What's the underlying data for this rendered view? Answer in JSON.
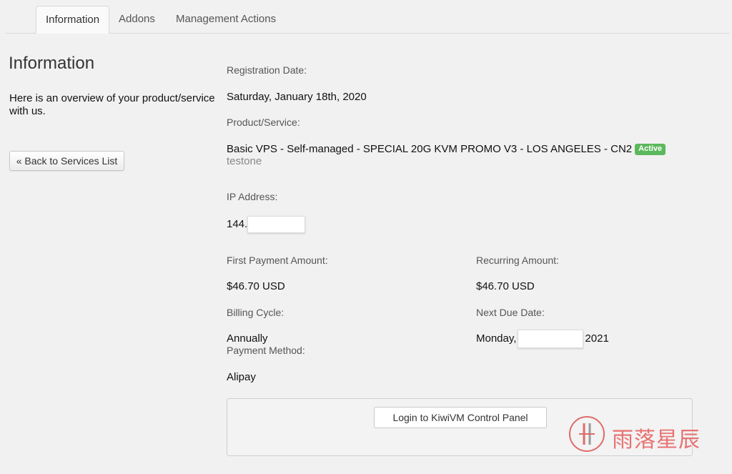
{
  "tabs": [
    {
      "label": "Information",
      "active": true
    },
    {
      "label": "Addons",
      "active": false
    },
    {
      "label": "Management Actions",
      "active": false
    }
  ],
  "sidebar": {
    "title": "Information",
    "overview": "Here is an overview of your product/service with us.",
    "back_button": "« Back to Services List"
  },
  "details": {
    "registration_date_label": "Registration Date:",
    "registration_date": "Saturday, January 18th, 2020",
    "product_label": "Product/Service:",
    "product": "Basic VPS - Self-managed - SPECIAL 20G KVM PROMO V3 - LOS ANGELES - CN2",
    "status_badge": "Active",
    "hostname": "testone",
    "ip_label": "IP Address:",
    "ip_prefix": "144.",
    "first_payment_label": "First Payment Amount:",
    "first_payment": "$46.70 USD",
    "recurring_label": "Recurring Amount:",
    "recurring": "$46.70 USD",
    "billing_cycle_label": "Billing Cycle:",
    "billing_cycle": "Annually",
    "next_due_label": "Next Due Date:",
    "next_due_prefix": "Monday,",
    "next_due_suffix": "2021",
    "payment_method_label": "Payment Method:",
    "payment_method": "Alipay"
  },
  "actions": {
    "login_button": "Login to KiwiVM Control Panel"
  },
  "watermark": {
    "text": "雨落星辰"
  },
  "colors": {
    "badge_active": "#5cb85c",
    "watermark": "#e87272"
  }
}
